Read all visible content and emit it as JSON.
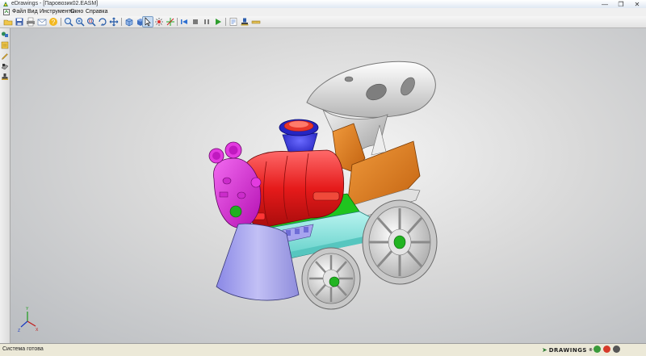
{
  "window": {
    "title": "eDrawings - [Паровозик02.EASM]",
    "minimize_glyph": "—",
    "restore_glyph": "❐",
    "close_glyph": "✕"
  },
  "menu": {
    "items": [
      "Файл",
      "Вид",
      "Инструменты",
      "Окно",
      "Справка"
    ]
  },
  "toolbar": {
    "buttons": [
      "open",
      "save",
      "print",
      "email",
      "measure-help",
      "zoom-to-fit",
      "zoom-in-out",
      "zoom-to-area",
      "rotate",
      "pan",
      "display-style",
      "shaded",
      "select",
      "explode",
      "3d-pointer",
      "go-to-start",
      "stop",
      "pause",
      "play",
      "markup",
      "stamp",
      "measure"
    ],
    "active": "select"
  },
  "left_toolbar": {
    "buttons": [
      "components",
      "configurations",
      "markup",
      "section",
      "stamp"
    ]
  },
  "status": {
    "text": "Система готова",
    "brand": "DRAWINGS",
    "brand_mark": "®"
  },
  "colors": {
    "smokestack": "#4a4af0",
    "boiler": "#ef2020",
    "face": "#e02ae0",
    "cab": "#e07a1a",
    "roof": "#eeeeee",
    "cowcatcher": "#a9a7ee",
    "chassis": "#82e0dc",
    "frame": "#20c020",
    "wheels": "#dcdcdc"
  }
}
